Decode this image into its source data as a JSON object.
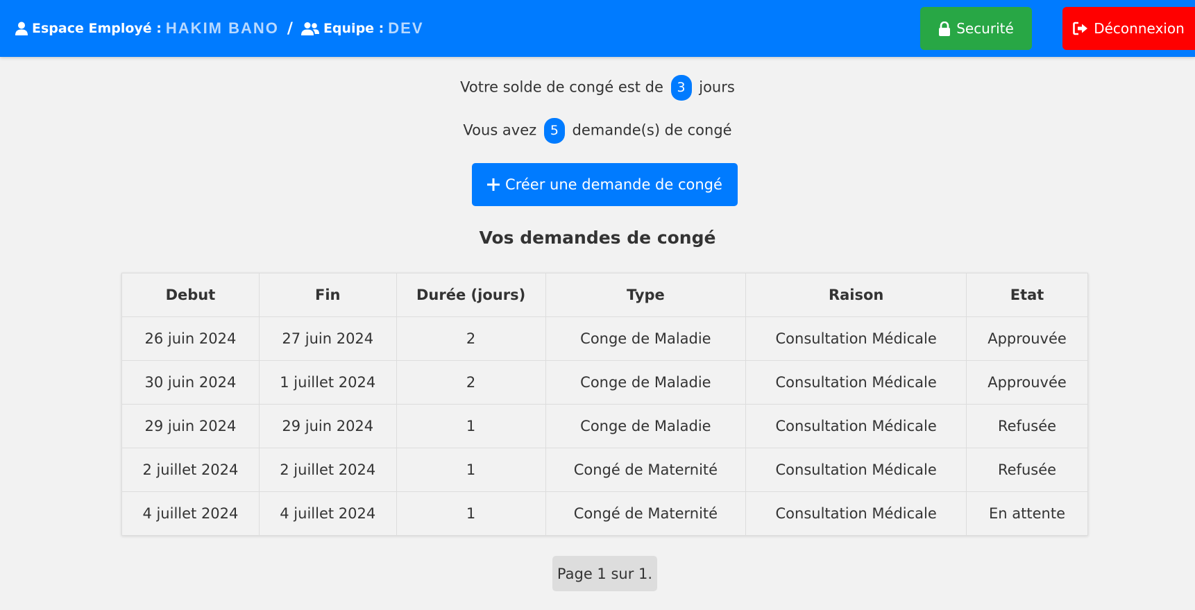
{
  "header": {
    "employee_label": "Espace Employé :",
    "employee_name": "HAKIM BANO",
    "separator": "/",
    "team_label": "Equipe :",
    "team_name": "DEV",
    "security_label": "Securité",
    "logout_label": "Déconnexion",
    "colors": {
      "bar": "#007bff",
      "security": "#28a745",
      "logout": "#ff0000"
    },
    "icons": [
      "user-icon",
      "users-icon",
      "lock-icon",
      "sign-out-icon"
    ]
  },
  "summary": {
    "balance_prefix": "Votre solde de congé est de",
    "balance_value": "3",
    "balance_suffix": "jours",
    "requests_prefix": "Vous avez",
    "requests_value": "5",
    "requests_suffix": "demande(s) de congé"
  },
  "create_button": {
    "label": "Créer une demande de congé",
    "icon": "plus-icon"
  },
  "table": {
    "title": "Vos demandes de congé",
    "headers": [
      "Debut",
      "Fin",
      "Durée (jours)",
      "Type",
      "Raison",
      "Etat"
    ],
    "rows": [
      [
        "26 juin 2024",
        "27 juin 2024",
        "2",
        "Conge de Maladie",
        "Consultation Médicale",
        "Approuvée"
      ],
      [
        "30 juin 2024",
        "1 juillet 2024",
        "2",
        "Conge de Maladie",
        "Consultation Médicale",
        "Approuvée"
      ],
      [
        "29 juin 2024",
        "29 juin 2024",
        "1",
        "Conge de Maladie",
        "Consultation Médicale",
        "Refusée"
      ],
      [
        "2 juillet 2024",
        "2 juillet 2024",
        "1",
        "Congé de Maternité",
        "Consultation Médicale",
        "Refusée"
      ],
      [
        "4 juillet 2024",
        "4 juillet 2024",
        "1",
        "Congé de Maternité",
        "Consultation Médicale",
        "En attente"
      ]
    ]
  },
  "pagination": {
    "label": "Page 1 sur 1."
  }
}
